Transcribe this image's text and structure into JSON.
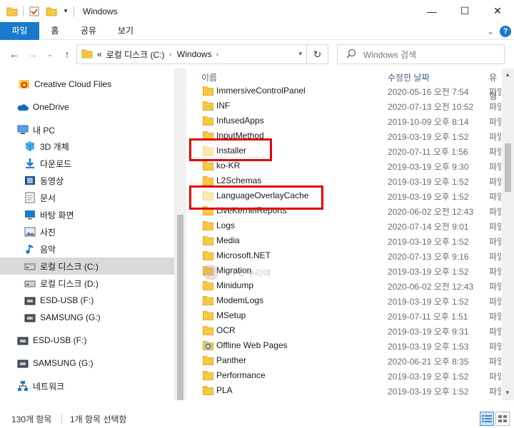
{
  "window": {
    "title": "Windows",
    "controls": {
      "minimize": "—",
      "maximize": "☐",
      "close": "✕"
    }
  },
  "ribbon": {
    "tabs": [
      "파일",
      "홈",
      "공유",
      "보기"
    ],
    "help": "?"
  },
  "address": {
    "overflow": "«",
    "crumbs": [
      "로컬 디스크 (C:)",
      "Windows"
    ]
  },
  "search": {
    "placeholder": "Windows 검색"
  },
  "nav": {
    "items": [
      {
        "label": "Creative Cloud Files",
        "icon": "creative-cloud-icon"
      },
      {
        "label": "OneDrive",
        "icon": "onedrive-icon"
      },
      {
        "label": "내 PC",
        "icon": "pc-icon"
      },
      {
        "label": "3D 개체",
        "icon": "3d-objects-icon"
      },
      {
        "label": "다운로드",
        "icon": "download-icon"
      },
      {
        "label": "동영상",
        "icon": "video-icon"
      },
      {
        "label": "문서",
        "icon": "document-icon"
      },
      {
        "label": "바탕 화면",
        "icon": "desktop-icon"
      },
      {
        "label": "사진",
        "icon": "picture-icon"
      },
      {
        "label": "음악",
        "icon": "music-icon"
      },
      {
        "label": "로컬 디스크 (C:)",
        "icon": "drive-icon",
        "selected": true
      },
      {
        "label": "로컬 디스크 (D:)",
        "icon": "drive-icon"
      },
      {
        "label": "ESD-USB (F:)",
        "icon": "usb-drive-icon"
      },
      {
        "label": "SAMSUNG (G:)",
        "icon": "usb-drive-icon"
      },
      {
        "label": "ESD-USB (F:)",
        "icon": "usb-drive-icon"
      },
      {
        "label": "SAMSUNG (G:)",
        "icon": "usb-drive-icon"
      },
      {
        "label": "네트워크",
        "icon": "network-icon"
      }
    ]
  },
  "list": {
    "columns": {
      "name": "이름",
      "modified": "수정한 날짜",
      "type": "유형"
    },
    "rows": [
      {
        "name": "ImmersiveControlPanel",
        "date": "2020-05-16 오전 7:54",
        "type": "파일"
      },
      {
        "name": "INF",
        "date": "2020-07-13 오전 10:52",
        "type": "파일"
      },
      {
        "name": "InfusedApps",
        "date": "2019-10-09 오후 8:14",
        "type": "파일"
      },
      {
        "name": "InputMethod",
        "date": "2019-03-19 오후 1:52",
        "type": "파일"
      },
      {
        "name": "Installer",
        "date": "2020-07-11 오후 1:56",
        "type": "파일",
        "faint": true
      },
      {
        "name": "ko-KR",
        "date": "2019-03-19 오후 9:30",
        "type": "파일"
      },
      {
        "name": "L2Schemas",
        "date": "2019-03-19 오후 1:52",
        "type": "파일"
      },
      {
        "name": "LanguageOverlayCache",
        "date": "2019-03-19 오후 1:52",
        "type": "파일",
        "faint": true
      },
      {
        "name": "LiveKernelReports",
        "date": "2020-06-02 오전 12:43",
        "type": "파일"
      },
      {
        "name": "Logs",
        "date": "2020-07-14 오전 9:01",
        "type": "파일"
      },
      {
        "name": "Media",
        "date": "2019-03-19 오후 1:52",
        "type": "파일"
      },
      {
        "name": "Microsoft.NET",
        "date": "2020-07-13 오후 9:16",
        "type": "파일"
      },
      {
        "name": "Migration",
        "date": "2019-03-19 오후 1:52",
        "type": "파일"
      },
      {
        "name": "Minidump",
        "date": "2020-06-02 오전 12:43",
        "type": "파일"
      },
      {
        "name": "ModemLogs",
        "date": "2019-03-19 오후 1:52",
        "type": "파일"
      },
      {
        "name": "MSetup",
        "date": "2019-07-11 오후 1:51",
        "type": "파일"
      },
      {
        "name": "OCR",
        "date": "2019-03-19 오후 9:31",
        "type": "파일"
      },
      {
        "name": "Offline Web Pages",
        "date": "2019-03-19 오후 1:53",
        "type": "파일",
        "special": true
      },
      {
        "name": "Panther",
        "date": "2020-06-21 오후 8:35",
        "type": "파일"
      },
      {
        "name": "Performance",
        "date": "2019-03-19 오후 1:52",
        "type": "파일"
      },
      {
        "name": "PLA",
        "date": "2019-03-19 오후 1:52",
        "type": "파일"
      }
    ],
    "watermark": "PC 수리야"
  },
  "status": {
    "count": "130개 항목",
    "selected": "1개 항목 선택함"
  },
  "colors": {
    "accent": "#1979ca",
    "highlight_border": "#e30000",
    "folder": "#f7c843"
  }
}
